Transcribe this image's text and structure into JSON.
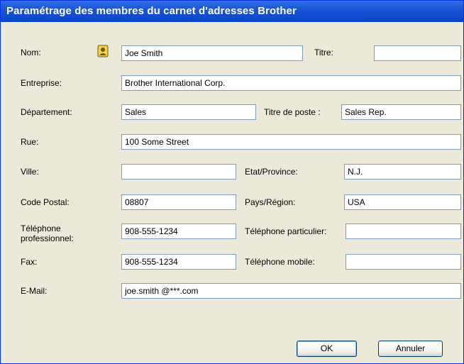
{
  "window": {
    "title": "Paramétrage des membres du carnet d'adresses Brother"
  },
  "labels": {
    "nom": "Nom:",
    "titre": "Titre:",
    "entreprise": "Entreprise:",
    "departement": "Département:",
    "titre_poste": "Titre de poste :",
    "rue": "Rue:",
    "ville": "Ville:",
    "etat": "Etat/Province:",
    "code_postal": "Code Postal:",
    "pays": "Pays/Région:",
    "tel_pro_1": "Téléphone",
    "tel_pro_2": "professionnel:",
    "tel_part": "Téléphone particulier:",
    "fax": "Fax:",
    "tel_mobile": "Téléphone mobile:",
    "email": "E-Mail:"
  },
  "fields": {
    "nom": "Joe Smith",
    "titre": "",
    "entreprise": "Brother International Corp.",
    "departement": "Sales",
    "titre_poste": "Sales Rep.",
    "rue": "100 Some Street",
    "ville": "",
    "etat": "N.J.",
    "code_postal": "08807",
    "pays": "USA",
    "tel_pro": "908-555-1234",
    "tel_part": "",
    "fax": "908-555-1234",
    "tel_mobile": "",
    "email": "joe.smith @***.com"
  },
  "buttons": {
    "ok": "OK",
    "annuler": "Annuler"
  },
  "icons": {
    "contact": "contact-card-icon"
  }
}
